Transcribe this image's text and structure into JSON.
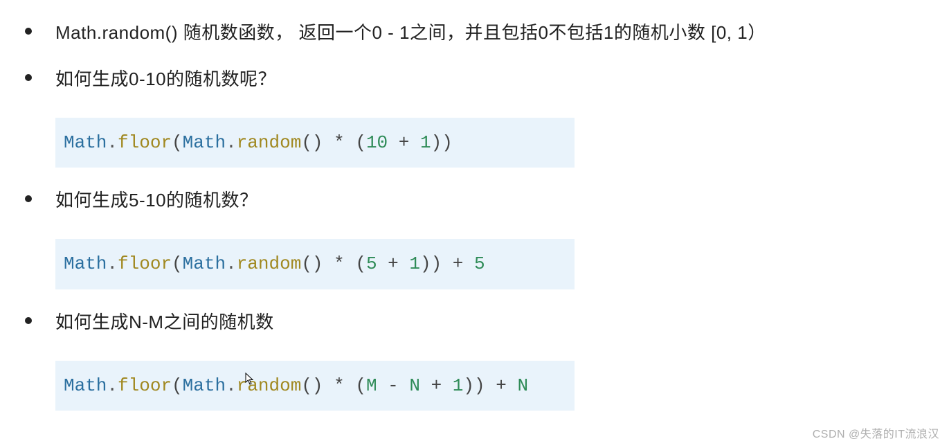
{
  "items": [
    {
      "text": "Math.random()  随机数函数，  返回一个0 - 1之间，并且包括0不包括1的随机小数  [0, 1）",
      "code": null
    },
    {
      "text": "如何生成0-10的随机数呢？",
      "code": {
        "tokens": [
          {
            "t": "Math",
            "c": "tok-class"
          },
          {
            "t": ".",
            "c": "tok-dot"
          },
          {
            "t": "floor",
            "c": "tok-method"
          },
          {
            "t": "(",
            "c": "tok-paren"
          },
          {
            "t": "Math",
            "c": "tok-class"
          },
          {
            "t": ".",
            "c": "tok-dot"
          },
          {
            "t": "random",
            "c": "tok-method"
          },
          {
            "t": "()",
            "c": "tok-paren"
          },
          {
            "t": " * ",
            "c": "tok-op"
          },
          {
            "t": "(",
            "c": "tok-paren"
          },
          {
            "t": "10",
            "c": "tok-num"
          },
          {
            "t": " + ",
            "c": "tok-op"
          },
          {
            "t": "1",
            "c": "tok-num"
          },
          {
            "t": "))",
            "c": "tok-paren"
          }
        ]
      }
    },
    {
      "text": "如何生成5-10的随机数？",
      "code": {
        "tokens": [
          {
            "t": "Math",
            "c": "tok-class"
          },
          {
            "t": ".",
            "c": "tok-dot"
          },
          {
            "t": "floor",
            "c": "tok-method"
          },
          {
            "t": "(",
            "c": "tok-paren"
          },
          {
            "t": "Math",
            "c": "tok-class"
          },
          {
            "t": ".",
            "c": "tok-dot"
          },
          {
            "t": "random",
            "c": "tok-method"
          },
          {
            "t": "()",
            "c": "tok-paren"
          },
          {
            "t": " * ",
            "c": "tok-op"
          },
          {
            "t": "(",
            "c": "tok-paren"
          },
          {
            "t": "5",
            "c": "tok-num"
          },
          {
            "t": " + ",
            "c": "tok-op"
          },
          {
            "t": "1",
            "c": "tok-num"
          },
          {
            "t": "))",
            "c": "tok-paren"
          },
          {
            "t": " + ",
            "c": "tok-op"
          },
          {
            "t": "5",
            "c": "tok-num"
          }
        ]
      }
    },
    {
      "text": "如何生成N-M之间的随机数",
      "code": {
        "tokens": [
          {
            "t": "Math",
            "c": "tok-class"
          },
          {
            "t": ".",
            "c": "tok-dot"
          },
          {
            "t": "floor",
            "c": "tok-method"
          },
          {
            "t": "(",
            "c": "tok-paren"
          },
          {
            "t": "Math",
            "c": "tok-class"
          },
          {
            "t": ".",
            "c": "tok-dot"
          },
          {
            "t": "random",
            "c": "tok-method"
          },
          {
            "t": "()",
            "c": "tok-paren"
          },
          {
            "t": " * ",
            "c": "tok-op"
          },
          {
            "t": "(",
            "c": "tok-paren"
          },
          {
            "t": "M",
            "c": "tok-var"
          },
          {
            "t": " - ",
            "c": "tok-op"
          },
          {
            "t": "N",
            "c": "tok-var"
          },
          {
            "t": " + ",
            "c": "tok-op"
          },
          {
            "t": "1",
            "c": "tok-num"
          },
          {
            "t": "))",
            "c": "tok-paren"
          },
          {
            "t": " + ",
            "c": "tok-op"
          },
          {
            "t": "N",
            "c": "tok-var"
          }
        ]
      }
    }
  ],
  "watermark": "CSDN @失落的IT流浪汉"
}
